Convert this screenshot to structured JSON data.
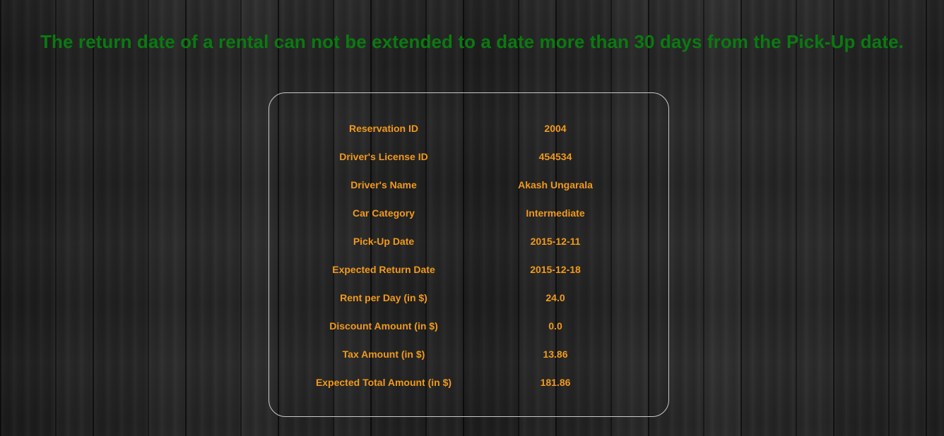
{
  "message": "The return date of a rental can not be extended to a date more than 30 days from the Pick-Up date.",
  "colors": {
    "message": "#0a7a10",
    "field_text": "#f19a1c",
    "panel_border": "#c9c9c9",
    "background": "#1c1c1c"
  },
  "reservation": {
    "rows": [
      {
        "label": "Reservation ID",
        "value": "2004"
      },
      {
        "label": "Driver's License ID",
        "value": "454534"
      },
      {
        "label": "Driver's Name",
        "value": "Akash Ungarala"
      },
      {
        "label": "Car Category",
        "value": "Intermediate"
      },
      {
        "label": "Pick-Up Date",
        "value": "2015-12-11"
      },
      {
        "label": "Expected Return Date",
        "value": "2015-12-18"
      },
      {
        "label": "Rent per Day (in $)",
        "value": "24.0"
      },
      {
        "label": "Discount Amount (in $)",
        "value": "0.0"
      },
      {
        "label": "Tax Amount (in $)",
        "value": "13.86"
      },
      {
        "label": "Expected Total Amount (in $)",
        "value": "181.86"
      }
    ]
  }
}
